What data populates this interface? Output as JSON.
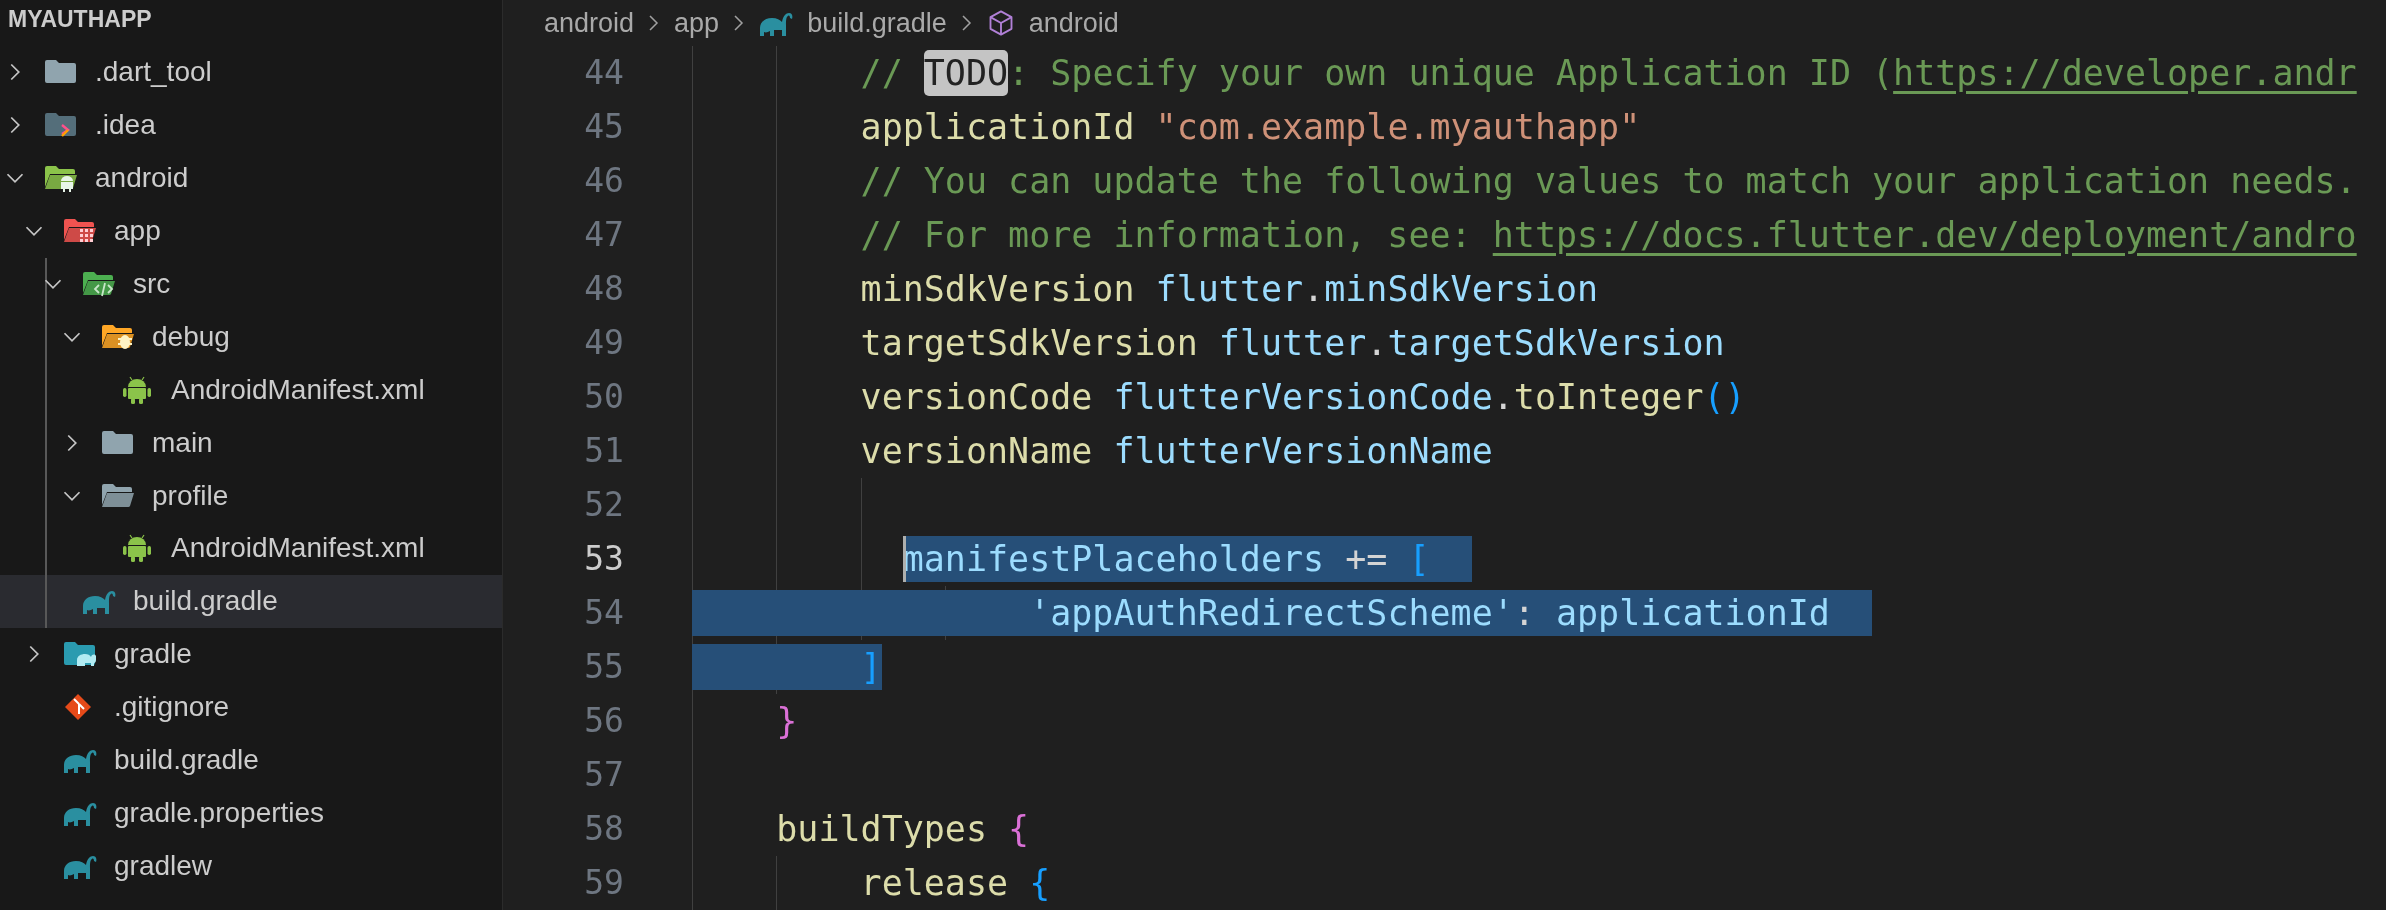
{
  "explorer": {
    "title": "MYAUTHAPP",
    "tree": [
      {
        "name": ".dart_tool",
        "kind": "folder",
        "expanded": false,
        "selected": false
      },
      {
        "name": ".idea",
        "kind": "idea-folder",
        "expanded": false,
        "selected": false
      },
      {
        "name": "android",
        "kind": "android-folder",
        "expanded": true,
        "selected": false,
        "children": [
          {
            "name": "app",
            "kind": "app-folder",
            "expanded": true,
            "selected": false,
            "children": [
              {
                "name": "src",
                "kind": "src-folder",
                "expanded": true,
                "selected": false,
                "children": [
                  {
                    "name": "debug",
                    "kind": "debug-folder",
                    "expanded": true,
                    "selected": false,
                    "children": [
                      {
                        "name": "AndroidManifest.xml",
                        "kind": "android-file",
                        "selected": false
                      }
                    ]
                  },
                  {
                    "name": "main",
                    "kind": "folder",
                    "expanded": false,
                    "selected": false
                  },
                  {
                    "name": "profile",
                    "kind": "folder",
                    "expanded": true,
                    "selected": false,
                    "children": [
                      {
                        "name": "AndroidManifest.xml",
                        "kind": "android-file",
                        "selected": false
                      }
                    ]
                  }
                ]
              },
              {
                "name": "build.gradle",
                "kind": "gradle-file",
                "selected": true
              }
            ]
          },
          {
            "name": "gradle",
            "kind": "gradle-folder",
            "expanded": false,
            "selected": false
          },
          {
            "name": ".gitignore",
            "kind": "git-file",
            "selected": false
          },
          {
            "name": "build.gradle",
            "kind": "gradle-file",
            "selected": false
          },
          {
            "name": "gradle.properties",
            "kind": "gradle-file",
            "selected": false
          },
          {
            "name": "gradlew",
            "kind": "gradle-file",
            "selected": false
          }
        ]
      }
    ]
  },
  "breadcrumb": [
    {
      "label": "android",
      "kind": "folder"
    },
    {
      "label": "app",
      "kind": "folder"
    },
    {
      "label": "build.gradle",
      "kind": "gradle-file"
    },
    {
      "label": "android",
      "kind": "symbol"
    }
  ],
  "editor": {
    "lines": [
      {
        "number": "44",
        "current": false,
        "tokens": [
          {
            "text": "        // ",
            "kind": "comment",
            "selected": false
          },
          {
            "text": "TODO",
            "kind": "todo",
            "selected": false
          },
          {
            "text": ": Specify your own unique Application ID (",
            "kind": "comment",
            "selected": false
          },
          {
            "text": "https://developer.andr",
            "kind": "link",
            "selected": false
          }
        ]
      },
      {
        "number": "45",
        "current": false,
        "tokens": [
          {
            "text": "        applicationId ",
            "kind": "method",
            "selected": false
          },
          {
            "text": "\"com.example.myauthapp\"",
            "kind": "string",
            "selected": false
          }
        ]
      },
      {
        "number": "46",
        "current": false,
        "tokens": [
          {
            "text": "        // You can update the following values to match your application needs.",
            "kind": "comment",
            "selected": false
          }
        ]
      },
      {
        "number": "47",
        "current": false,
        "tokens": [
          {
            "text": "        // For more information, see: ",
            "kind": "comment",
            "selected": false
          },
          {
            "text": "https://docs.flutter.dev/deployment/andro",
            "kind": "link",
            "selected": false
          }
        ]
      },
      {
        "number": "48",
        "current": false,
        "tokens": [
          {
            "text": "        minSdkVersion ",
            "kind": "method",
            "selected": false
          },
          {
            "text": "flutter",
            "kind": "property",
            "selected": false
          },
          {
            "text": ".",
            "kind": "punct",
            "selected": false
          },
          {
            "text": "minSdkVersion",
            "kind": "property",
            "selected": false
          }
        ]
      },
      {
        "number": "49",
        "current": false,
        "tokens": [
          {
            "text": "        targetSdkVersion ",
            "kind": "method",
            "selected": false
          },
          {
            "text": "flutter",
            "kind": "property",
            "selected": false
          },
          {
            "text": ".",
            "kind": "punct",
            "selected": false
          },
          {
            "text": "targetSdkVersion",
            "kind": "property",
            "selected": false
          }
        ]
      },
      {
        "number": "50",
        "current": false,
        "tokens": [
          {
            "text": "        versionCode ",
            "kind": "method",
            "selected": false
          },
          {
            "text": "flutterVersionCode",
            "kind": "property",
            "selected": false
          },
          {
            "text": ".",
            "kind": "punct",
            "selected": false
          },
          {
            "text": "toInteger",
            "kind": "method",
            "selected": false
          },
          {
            "text": "()",
            "kind": "bracket",
            "selected": false
          }
        ]
      },
      {
        "number": "51",
        "current": false,
        "tokens": [
          {
            "text": "        versionName ",
            "kind": "method",
            "selected": false
          },
          {
            "text": "flutterVersionName",
            "kind": "property",
            "selected": false
          }
        ]
      },
      {
        "number": "52",
        "current": false
      },
      {
        "number": "53",
        "current": true,
        "tokens": [
          {
            "text": "          manifestPlaceholders ",
            "kind": "property",
            "selected": true
          },
          {
            "text": "+= ",
            "kind": "punct",
            "selected": true
          },
          {
            "text": "[",
            "kind": "bracket",
            "selected": true
          }
        ]
      },
      {
        "number": "54",
        "current": false,
        "tokens": [
          {
            "text": "                'appAuthRedirectScheme'",
            "kind": "property",
            "selected": true
          },
          {
            "text": ": ",
            "kind": "punct",
            "selected": true
          },
          {
            "text": "applicationId",
            "kind": "property",
            "selected": true
          }
        ]
      },
      {
        "number": "55",
        "current": false,
        "tokens": [
          {
            "text": "        ]",
            "kind": "bracket",
            "selected": true
          }
        ]
      },
      {
        "number": "56",
        "current": false,
        "tokens": [
          {
            "text": "    }",
            "kind": "brace",
            "selected": false
          }
        ]
      },
      {
        "number": "57",
        "current": false
      },
      {
        "number": "58",
        "current": false,
        "tokens": [
          {
            "text": "    buildTypes ",
            "kind": "method",
            "selected": false
          },
          {
            "text": "{",
            "kind": "brace",
            "selected": false
          }
        ]
      },
      {
        "number": "59",
        "current": false,
        "tokens": [
          {
            "text": "        release ",
            "kind": "method",
            "selected": false
          },
          {
            "text": "{",
            "kind": "bracket",
            "selected": false
          }
        ]
      }
    ]
  }
}
